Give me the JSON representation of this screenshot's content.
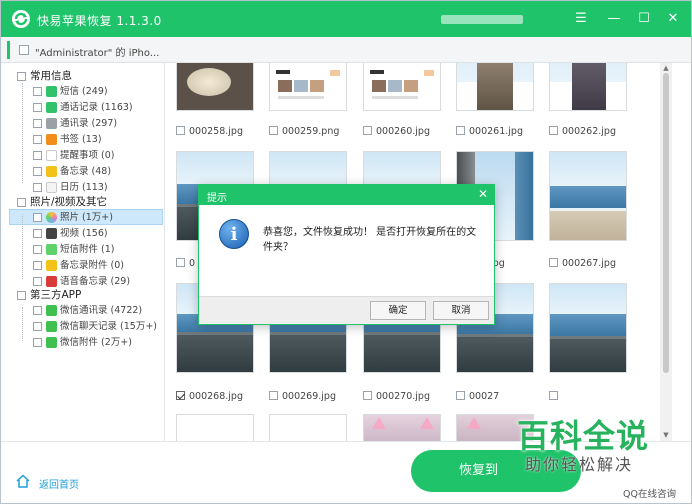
{
  "app": {
    "title": "快易苹果恢复 1.1.3.0"
  },
  "window_controls": {
    "menu": "☰",
    "minimize": "—",
    "maximize": "☐",
    "close": "✕"
  },
  "device": {
    "name": "\"Administrator\" 的 iPho..."
  },
  "sidebar": {
    "categories": [
      {
        "label": "常用信息",
        "items": [
          {
            "label": "短信 (249)",
            "icon": "sms-icon",
            "color": "#32c26b"
          },
          {
            "label": "通话记录 (1163)",
            "icon": "phone-icon",
            "color": "#32c26b"
          },
          {
            "label": "通讯录 (297)",
            "icon": "contacts-icon",
            "color": "#9aa0a6"
          },
          {
            "label": "书签 (13)",
            "icon": "bookmark-icon",
            "color": "#f28c1b"
          },
          {
            "label": "提醒事项 (0)",
            "icon": "reminder-icon",
            "color": "#cfcfcf"
          },
          {
            "label": "备忘录 (48)",
            "icon": "notes-icon",
            "color": "#f2c21b"
          },
          {
            "label": "日历 (113)",
            "icon": "calendar-icon",
            "color": "#e0e0e0"
          }
        ]
      },
      {
        "label": "照片/视频及其它",
        "items": [
          {
            "label": "照片 (1万+)",
            "icon": "photos-icon",
            "color": "#f07ab0"
          },
          {
            "label": "视频 (156)",
            "icon": "video-icon",
            "color": "#444444"
          },
          {
            "label": "短信附件 (1)",
            "icon": "sms-attachment-icon",
            "color": "#5ed36a"
          },
          {
            "label": "备忘录附件 (0)",
            "icon": "notes-attachment-icon",
            "color": "#f2c21b"
          },
          {
            "label": "语音备忘录 (29)",
            "icon": "voice-memo-icon",
            "color": "#d93a3a"
          }
        ]
      },
      {
        "label": "第三方APP",
        "items": [
          {
            "label": "微信通讯录 (4722)",
            "icon": "wechat-contacts-icon",
            "color": "#3fc04f"
          },
          {
            "label": "微信聊天记录 (15万+)",
            "icon": "wechat-chat-icon",
            "color": "#3fc04f"
          },
          {
            "label": "微信附件 (2万+)",
            "icon": "wechat-attachment-icon",
            "color": "#3fc04f"
          }
        ]
      }
    ]
  },
  "files": {
    "row1": [
      "000258.jpg",
      "000259.png",
      "000260.jpg",
      "000261.jpg",
      "000262.jpg"
    ],
    "row2": [
      "0",
      "",
      "",
      ".66.jpg",
      "000267.jpg"
    ],
    "row3": [
      "000268.jpg",
      "000269.jpg",
      "000270.jpg",
      "00027",
      ""
    ]
  },
  "bottom": {
    "home_link": "返回首页",
    "recover_button": "恢复到"
  },
  "dialog": {
    "title": "提示",
    "message": "恭喜您，文件恢复成功！ 是否打开恢复所在的文件夹？",
    "ok": "确定",
    "cancel": "取消"
  },
  "watermark": {
    "title": "百科全说",
    "subtitle": "助你轻松解决",
    "qq": "QQ在线咨询"
  },
  "colors": {
    "accent": "#1ec36a",
    "link": "#1e9fda",
    "selection": "#cde8fb"
  }
}
